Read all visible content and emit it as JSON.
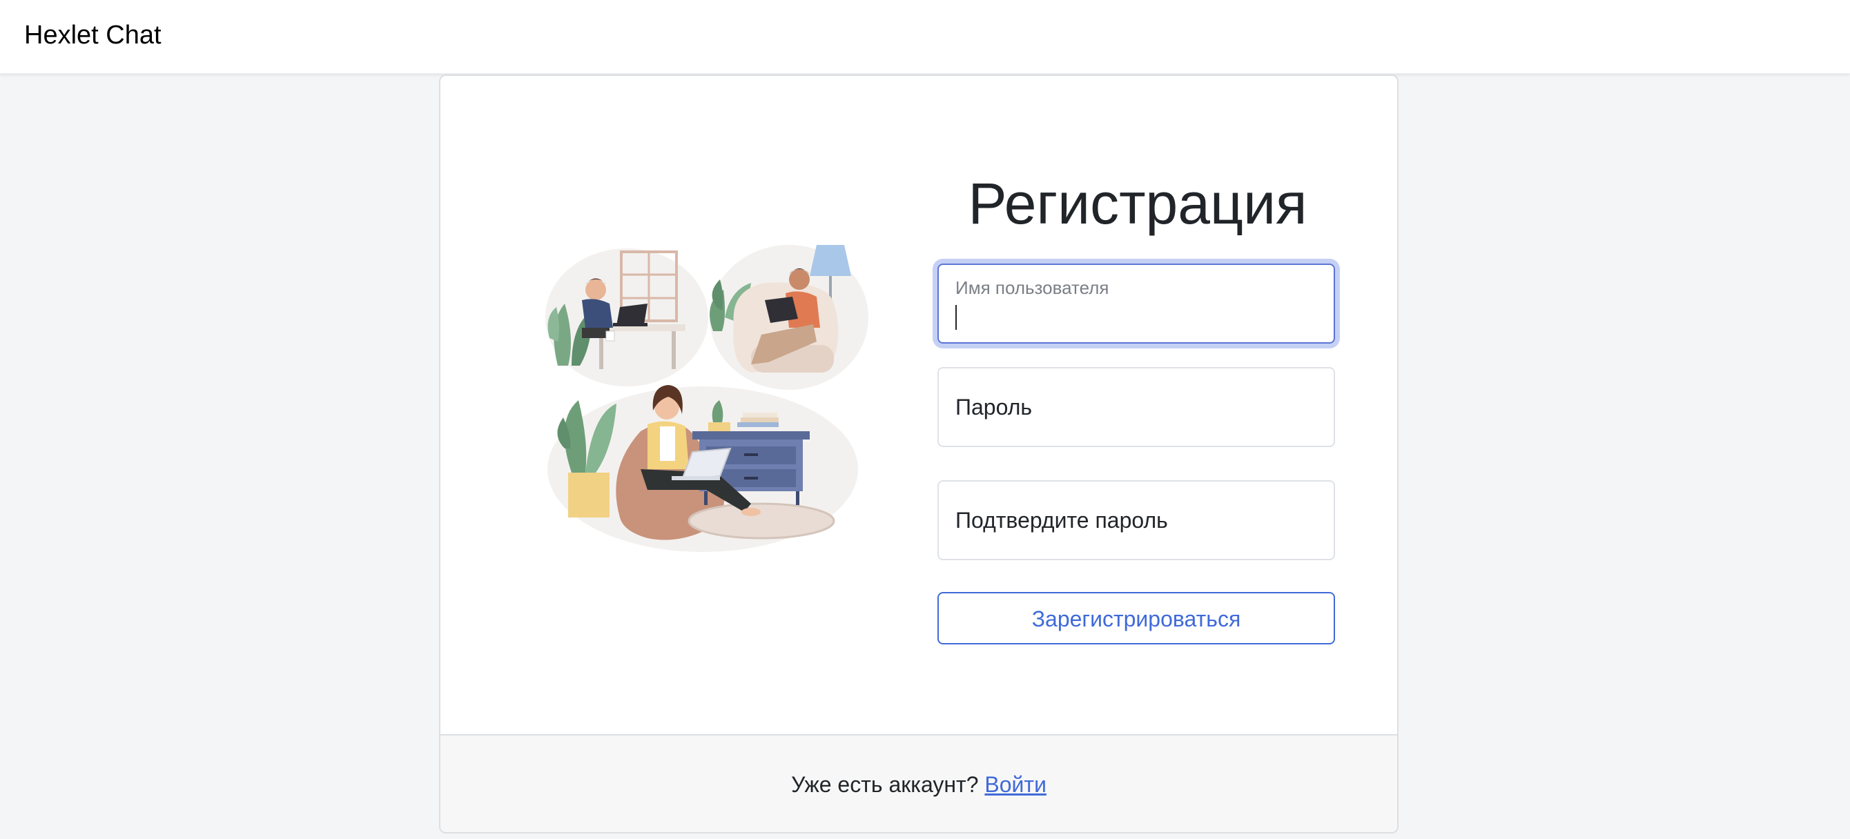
{
  "navbar": {
    "brand": "Hexlet Chat"
  },
  "signup": {
    "title": "Регистрация",
    "username_label": "Имя пользователя",
    "password_label": "Пароль",
    "confirm_label": "Подтвердите пароль",
    "submit_label": "Зарегистрироваться"
  },
  "footer": {
    "text": "Уже есть аккаунт?",
    "login_link": "Войти"
  },
  "colors": {
    "accent": "#3f6ad8",
    "focus_ring": "#c5d0f5",
    "page_background": "#f3f5f7"
  },
  "illustration": {
    "icon": "people-working-remotely-illustration"
  }
}
